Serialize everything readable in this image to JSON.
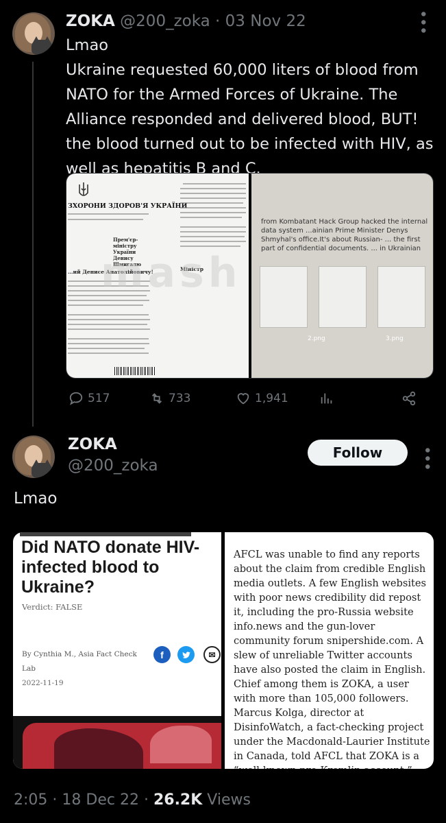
{
  "tweet1": {
    "name": "ZOKA",
    "handle": "@200_zoka",
    "separator": "·",
    "date": "03 Nov 22",
    "text_line1": "Lmao",
    "text_body": "Ukraine requested 60,000 liters of blood from NATO for the Armed Forces of Ukraine. The Alliance responded and delivered blood, BUT! the blood turned out to be infected with HIV, as well as hepatitis B and C.",
    "media": {
      "doc_title": "ЗХОРОНИ ЗДОРОВ'Я УКРАЇНИ",
      "doc_addressee": "Прем'єр-міністру України Денису Шмигалю",
      "doc_greeting": "…ий Денисе Анатолійовичу!",
      "doc_signature": "Міністр",
      "watermark": "mash",
      "hack_note": "from Kombatant Hack Group hacked the internal data system ...ainian Prime Minister Denys Shmyhal's office.It's about Russian- ... the first part of confidential documents. ... in Ukrainian",
      "thumb_labels": [
        "2.png",
        "3.png"
      ]
    },
    "stats": {
      "replies": "517",
      "retweets": "733",
      "likes": "1,941"
    }
  },
  "tweet2": {
    "name": "ZOKA",
    "handle": "@200_zoka",
    "follow_label": "Follow",
    "text": "Lmao",
    "article": {
      "title": "Did NATO donate HIV-infected blood to Ukraine?",
      "verdict": "Verdict: FALSE",
      "byline": "By Cynthia M., Asia Fact Check Lab",
      "date": "2022-11-19",
      "body": "AFCL was unable to find any reports about the claim from credible English media outlets. A few English websites with poor news credibility did repost it, including the pro-Russia website info.news and the gun-lover community forum snipershide.com. A slew of unreliable Twitter accounts have also posted the claim in English. Chief among them is ZOKA, a user with more than 105,000 followers. Marcus Kolga, director at DisinfoWatch, a fact-checking project under the Macdonald-Laurier Institute in Canada, told AFCL that ZOKA is a “well-known pro-Kremlin account.”"
    },
    "footer": {
      "time": "2:05",
      "date": "18 Dec 22",
      "views_count": "26.2K",
      "views_label": "Views",
      "separator": "·"
    }
  },
  "colors": {
    "background": "#000000",
    "text_primary": "#e7e9ea",
    "text_secondary": "#71767b",
    "follow_bg": "#eff3f4"
  },
  "icons": [
    "more-icon",
    "reply-icon",
    "retweet-icon",
    "like-icon",
    "analytics-icon",
    "share-icon",
    "facebook-icon",
    "twitter-icon",
    "mail-icon"
  ]
}
